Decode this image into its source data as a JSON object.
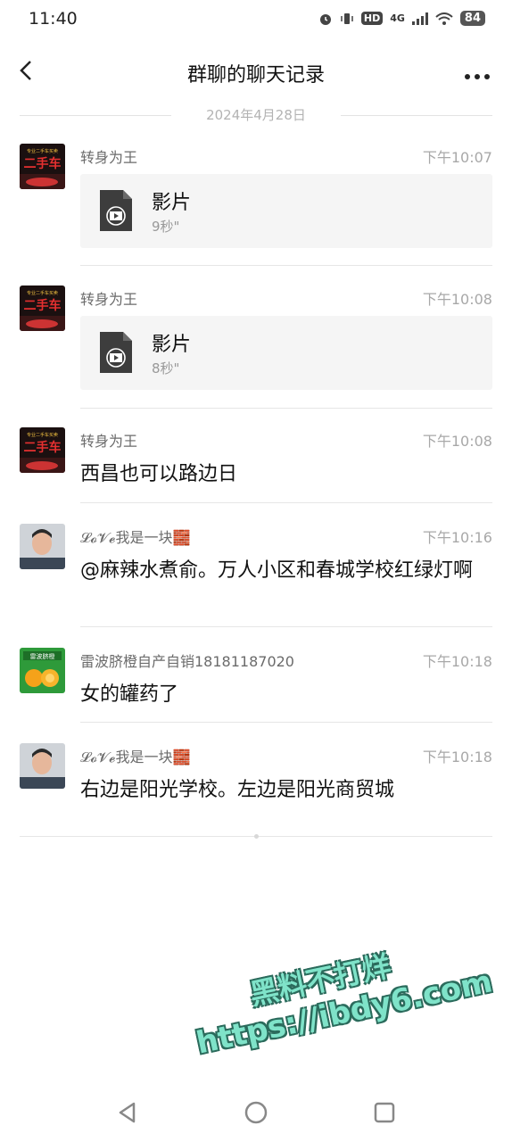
{
  "status_bar": {
    "time": "11:40",
    "network": "4G",
    "hd": "HD",
    "battery": "84"
  },
  "header": {
    "title": "群聊的聊天记录"
  },
  "date_divider": "2024年4月28日",
  "messages": [
    {
      "sender": "转身为王",
      "time": "下午10:07",
      "type": "video",
      "file_name": "影片",
      "duration": "9秒\""
    },
    {
      "sender": "转身为王",
      "time": "下午10:08",
      "type": "video",
      "file_name": "影片",
      "duration": "8秒\""
    },
    {
      "sender": "转身为王",
      "time": "下午10:08",
      "type": "text",
      "text": "西昌也可以路边日"
    },
    {
      "sender": "𝓛𝓸𝓥𝓮我是一块🧱",
      "time": "下午10:16",
      "type": "text",
      "text": "@麻辣水煮俞。万人小区和春城学校红绿灯啊"
    },
    {
      "sender": "雷波脐橙自产自销18181187020",
      "time": "下午10:18",
      "type": "text",
      "text": "女的罐药了"
    },
    {
      "sender": "𝓛𝓸𝓥𝓮我是一块🧱",
      "time": "下午10:18",
      "type": "text",
      "text": "右边是阳光学校。左边是阳光商贸城"
    }
  ],
  "avatar_text": {
    "car_line1": "专业二手车买卖",
    "car_main": "二手车",
    "orange_label": "雷波脐橙"
  },
  "watermark": {
    "line1": "黑料不打烊",
    "line2": "https://ibdy6.com"
  },
  "colors": {
    "card_bg": "#f5f5f5",
    "time_gray": "#a8a8a8",
    "sender_gray": "#6b6b6b",
    "watermark_fill": "#7fe3c9"
  }
}
